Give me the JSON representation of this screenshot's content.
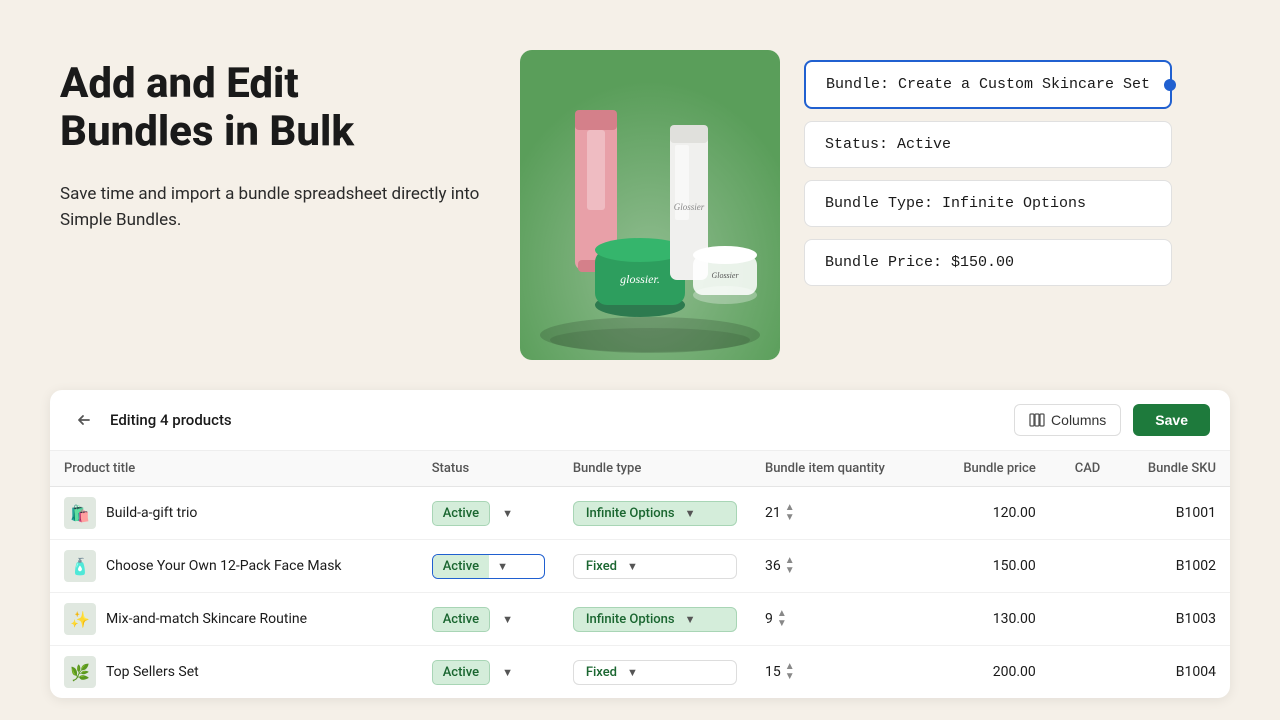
{
  "hero": {
    "heading_line1": "Add and Edit",
    "heading_line2": "Bundles in Bulk",
    "subtext": "Save time and import a bundle spreadsheet directly into Simple Bundles.",
    "image_alt": "Skincare products"
  },
  "info_cards": [
    {
      "id": "bundle-name",
      "label": "Bundle: Create a Custom Skincare Set",
      "highlighted": true
    },
    {
      "id": "bundle-status",
      "label": "Status: Active",
      "highlighted": false
    },
    {
      "id": "bundle-type",
      "label": "Bundle Type: Infinite Options",
      "highlighted": false
    },
    {
      "id": "bundle-price",
      "label": "Bundle Price: $150.00",
      "highlighted": false
    }
  ],
  "toolbar": {
    "editing_label": "Editing 4 products",
    "columns_label": "Columns",
    "save_label": "Save"
  },
  "table": {
    "columns": [
      {
        "key": "product_title",
        "label": "Product title"
      },
      {
        "key": "status",
        "label": "Status"
      },
      {
        "key": "bundle_type",
        "label": "Bundle type"
      },
      {
        "key": "bundle_item_quantity",
        "label": "Bundle item quantity"
      },
      {
        "key": "bundle_price",
        "label": "Bundle price"
      },
      {
        "key": "cad",
        "label": "CAD"
      },
      {
        "key": "bundle_sku",
        "label": "Bundle SKU"
      }
    ],
    "rows": [
      {
        "id": 1,
        "product_title": "Build-a-gift trio",
        "status": "Active",
        "bundle_type": "Infinite Options",
        "bundle_item_quantity": 21,
        "bundle_price": "120.00",
        "cad": "",
        "bundle_sku": "B1001",
        "thumb": "🛍️"
      },
      {
        "id": 2,
        "product_title": "Choose Your Own 12-Pack Face Mask",
        "status": "Active",
        "bundle_type": "Fixed",
        "bundle_item_quantity": 36,
        "bundle_price": "150.00",
        "cad": "",
        "bundle_sku": "B1002",
        "thumb": "🧴",
        "focused": true
      },
      {
        "id": 3,
        "product_title": "Mix-and-match Skincare Routine",
        "status": "Active",
        "bundle_type": "Infinite Options",
        "bundle_item_quantity": 9,
        "bundle_price": "130.00",
        "cad": "",
        "bundle_sku": "B1003",
        "thumb": "✨"
      },
      {
        "id": 4,
        "product_title": "Top Sellers Set",
        "status": "Active",
        "bundle_type": "Fixed",
        "bundle_item_quantity": 15,
        "bundle_price": "200.00",
        "cad": "",
        "bundle_sku": "B1004",
        "thumb": "🌿"
      }
    ]
  }
}
